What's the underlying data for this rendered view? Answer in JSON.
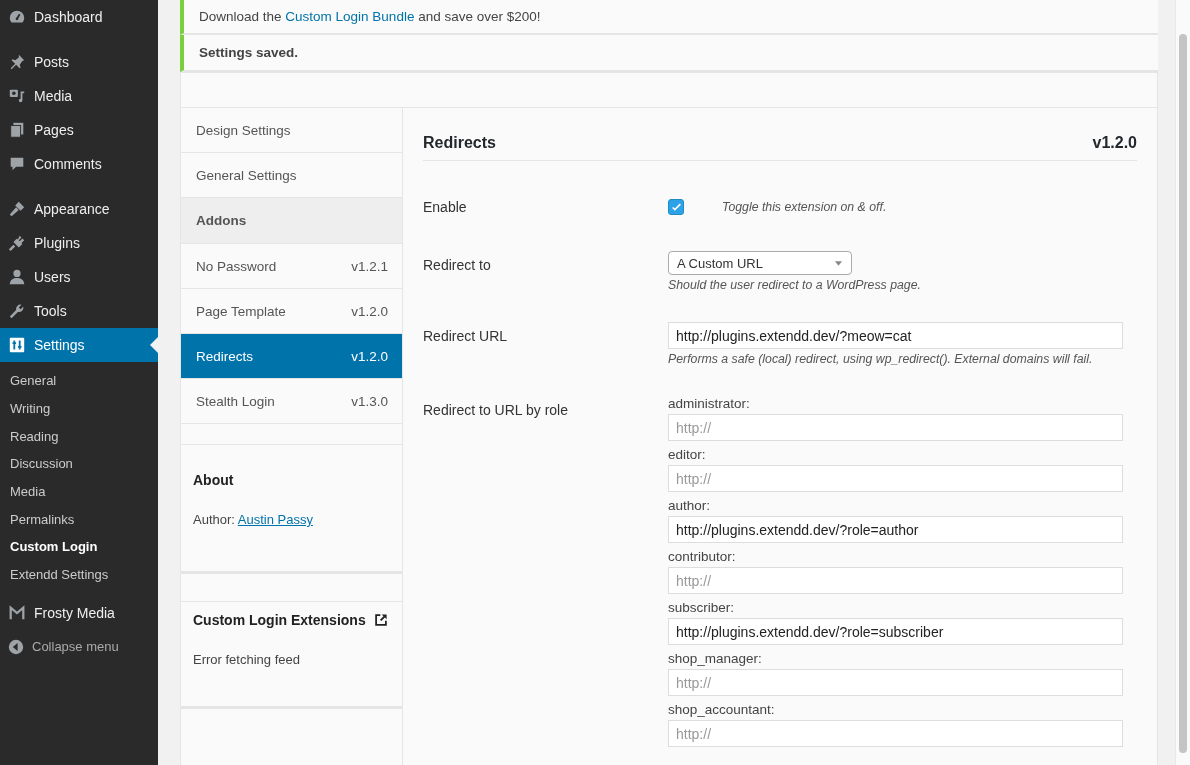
{
  "admin_menu": {
    "items": [
      {
        "kind": "item",
        "label": "Dashboard",
        "selected": false
      },
      {
        "kind": "separator"
      },
      {
        "kind": "item",
        "label": "Posts",
        "selected": false
      },
      {
        "kind": "item",
        "label": "Media",
        "selected": false
      },
      {
        "kind": "item",
        "label": "Pages",
        "selected": false
      },
      {
        "kind": "item",
        "label": "Comments",
        "selected": false
      },
      {
        "kind": "separator"
      },
      {
        "kind": "item",
        "label": "Appearance",
        "selected": false
      },
      {
        "kind": "item",
        "label": "Plugins",
        "selected": false
      },
      {
        "kind": "item",
        "label": "Users",
        "selected": false
      },
      {
        "kind": "item",
        "label": "Tools",
        "selected": false
      },
      {
        "kind": "item",
        "label": "Settings",
        "selected": true,
        "submenu": [
          {
            "label": "General",
            "current": false
          },
          {
            "label": "Writing",
            "current": false
          },
          {
            "label": "Reading",
            "current": false
          },
          {
            "label": "Discussion",
            "current": false
          },
          {
            "label": "Media",
            "current": false
          },
          {
            "label": "Permalinks",
            "current": false
          },
          {
            "label": "Custom Login",
            "current": true
          },
          {
            "label": "Extendd Settings",
            "current": false
          }
        ]
      },
      {
        "kind": "item",
        "label": "Frosty Media",
        "selected": false
      }
    ],
    "collapse": "Collapse menu"
  },
  "notices": [
    {
      "kind": "promo",
      "before": "Download the ",
      "link": "Custom Login Bundle",
      "after": " and save over $200!"
    },
    {
      "kind": "success",
      "text": "Settings saved."
    }
  ],
  "plugin_nav": {
    "items": [
      {
        "kind": "item",
        "label": "Design Settings",
        "selected": false
      },
      {
        "kind": "item",
        "label": "General Settings",
        "selected": false
      },
      {
        "kind": "heading",
        "label": "Addons"
      },
      {
        "kind": "item",
        "label": "No Password",
        "version": "v1.2.1",
        "selected": false
      },
      {
        "kind": "item",
        "label": "Page Template",
        "version": "v1.2.0",
        "selected": false
      },
      {
        "kind": "item",
        "label": "Redirects",
        "version": "v1.2.0",
        "selected": true
      },
      {
        "kind": "item",
        "label": "Stealth Login",
        "version": "v1.3.0",
        "selected": false
      }
    ]
  },
  "about": {
    "title": "About",
    "author_label": "Author:",
    "author_link": "Austin Passy"
  },
  "extensions": {
    "title": "Custom Login Extensions",
    "message": "Error fetching feed"
  },
  "section": {
    "title": "Redirects",
    "version": "v1.2.0"
  },
  "fields": [
    {
      "kind": "checkbox",
      "label": "Enable",
      "checked": true,
      "description": "Toggle this extension on & off."
    },
    {
      "kind": "select",
      "label": "Redirect to",
      "value": "A Custom URL",
      "description": "Should the user redirect to a WordPress page."
    },
    {
      "kind": "text",
      "label": "Redirect URL",
      "value": "http://plugins.extendd.dev/?meow=cat",
      "description": "Performs a safe (local) redirect, using wp_redirect(). External domains will fail."
    },
    {
      "kind": "roles",
      "label": "Redirect to URL by role",
      "roles": [
        {
          "name": "administrator:",
          "placeholder": "http://"
        },
        {
          "name": "editor:",
          "placeholder": "http://"
        },
        {
          "name": "author:",
          "value": "http://plugins.extendd.dev/?role=author"
        },
        {
          "name": "contributor:",
          "placeholder": "http://"
        },
        {
          "name": "subscriber:",
          "value": "http://plugins.extendd.dev/?role=subscriber"
        },
        {
          "name": "shop_manager:",
          "placeholder": "http://"
        },
        {
          "name": "shop_accountant:",
          "placeholder": "http://"
        }
      ]
    }
  ]
}
